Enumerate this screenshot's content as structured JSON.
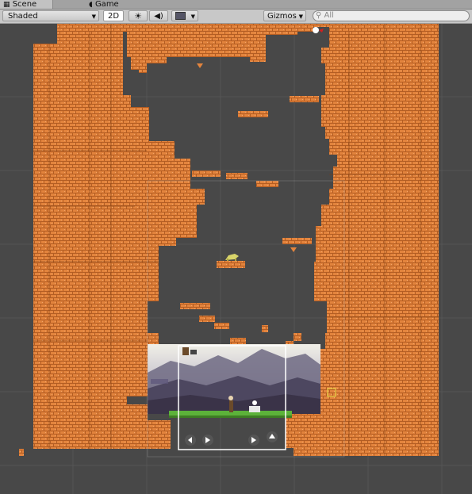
{
  "tabs": [
    {
      "label": "Scene",
      "icon": "grid-icon",
      "active": true
    },
    {
      "label": "Game",
      "icon": "pacman-icon",
      "active": false
    }
  ],
  "toolbar": {
    "shading_mode": "Shaded",
    "mode_2d_label": "2D",
    "gizmos_label": "Gizmos",
    "search_placeholder": "All"
  },
  "game_hud": {
    "left_button_icon": "arrow-left-icon",
    "right_button_icon": "arrow-right-icon",
    "action_button_icon": "arrow-right-icon",
    "jump_button_icon": "arrow-up-icon"
  },
  "colors": {
    "background": "#484848",
    "brick": "#e3843d",
    "brick_dark": "#b35d23",
    "ground": "#5cb23a",
    "camera_frame": "#ffffff"
  }
}
